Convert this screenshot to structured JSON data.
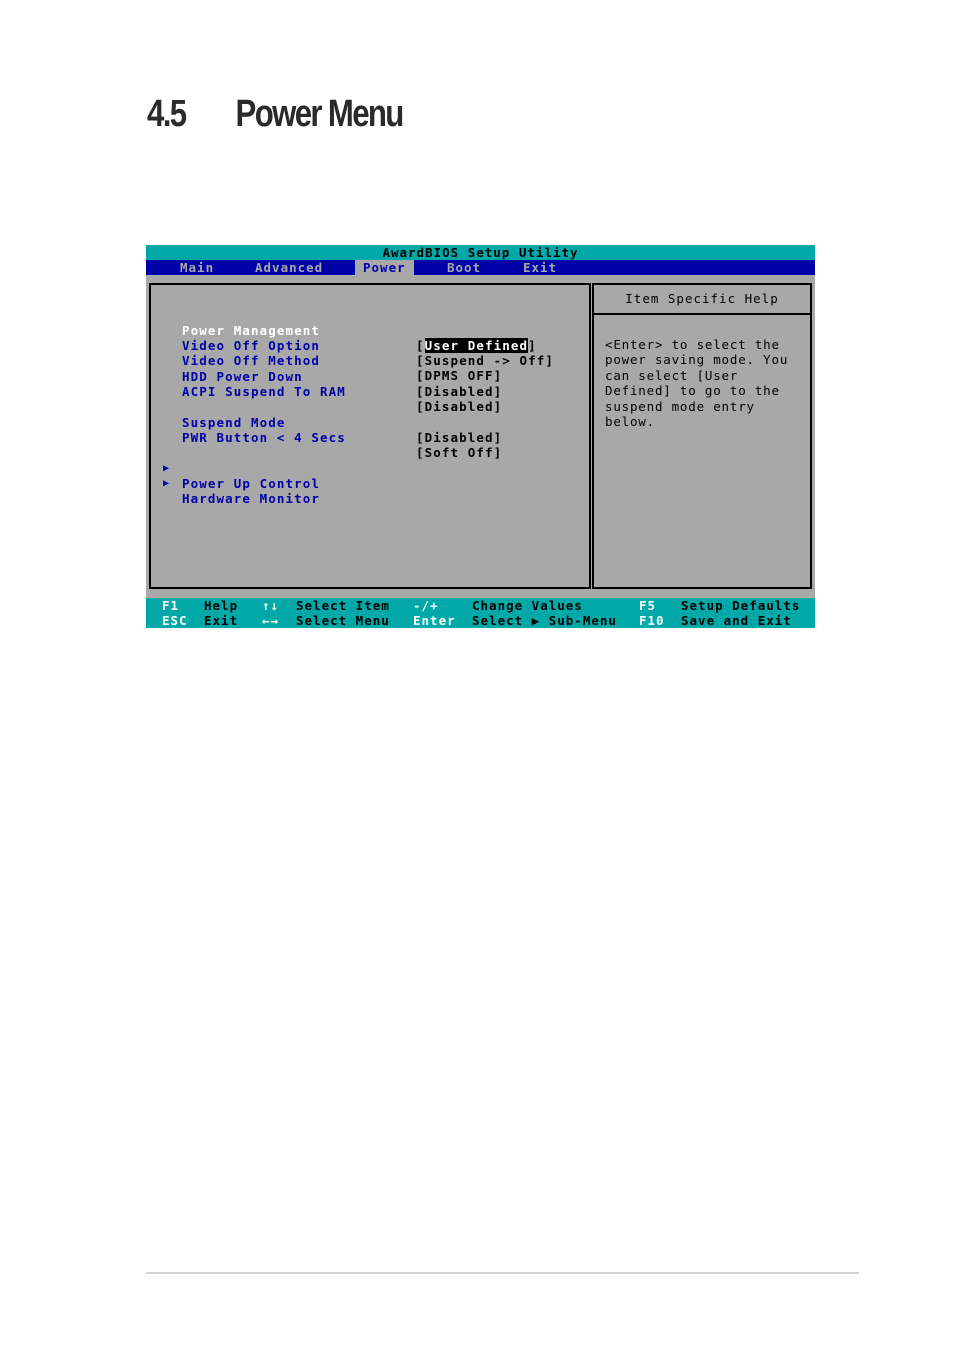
{
  "heading": {
    "number": "4.5",
    "title": "Power Menu"
  },
  "bios": {
    "title": "AwardBIOS Setup Utility",
    "tabs": [
      {
        "label": "Main",
        "active": false
      },
      {
        "label": "Advanced",
        "active": false
      },
      {
        "label": "Power",
        "active": true
      },
      {
        "label": "Boot",
        "active": false
      },
      {
        "label": "Exit",
        "active": false
      }
    ],
    "items": [
      {
        "label": "Power Management",
        "value": "User Defined",
        "selected": true
      },
      {
        "label": "Video Off Option",
        "value": "Suspend -> Off"
      },
      {
        "label": "Video Off Method",
        "value": "DPMS OFF"
      },
      {
        "label": "HDD Power Down",
        "value": "Disabled"
      },
      {
        "label": "ACPI Suspend To RAM",
        "value": "Disabled"
      },
      {
        "label": "Suspend Mode",
        "value": "Disabled"
      },
      {
        "label": "PWR Button < 4 Secs",
        "value": "Soft Off"
      }
    ],
    "submenus": [
      {
        "arrow": "▶",
        "label": "Power Up Control"
      },
      {
        "arrow": "▶",
        "label": "Hardware Monitor"
      }
    ],
    "help": {
      "title": "Item Specific Help",
      "text": "<Enter> to select the\npower saving mode. You\ncan select [User\nDefined] to go to the\nsuspend mode entry\nbelow."
    },
    "keys": [
      {
        "key": "F1",
        "desc": "Help"
      },
      {
        "key": "↑↓",
        "desc": "Select Item"
      },
      {
        "key": "-/+",
        "desc": "Change Values"
      },
      {
        "key": "F5",
        "desc": "Setup Defaults"
      },
      {
        "key": "ESC",
        "desc": "Exit"
      },
      {
        "key": "←→",
        "desc": "Select Menu"
      },
      {
        "key": "Enter",
        "desc": "Select ▶ Sub-Menu"
      },
      {
        "key": "F10",
        "desc": "Save and Exit"
      }
    ],
    "colors": {
      "title_bar": "#00a8a8",
      "menu_bar": "#0000a8",
      "body": "#a8a8a8",
      "item_text": "#0000a8",
      "selected_text": "#ffffff",
      "highlight_bg": "#000000"
    }
  }
}
